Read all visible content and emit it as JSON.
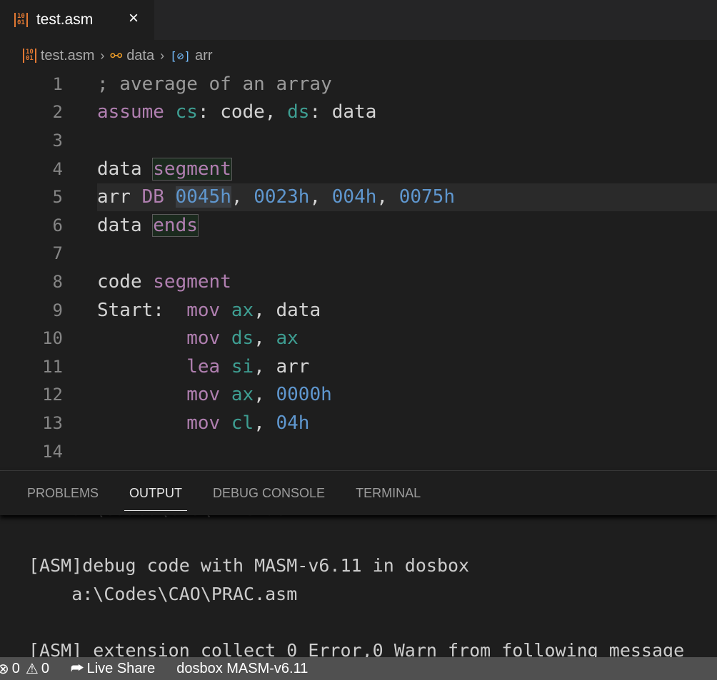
{
  "tab": {
    "icon": "binary-file-icon",
    "icon_text": "10 01",
    "label": "test.asm",
    "close": "×"
  },
  "breadcrumb": {
    "file": "test.asm",
    "namespace": "data",
    "symbol": "arr"
  },
  "editor": {
    "lines": [
      {
        "n": "1",
        "tokens": [
          {
            "t": "; average of an array",
            "c": "comment"
          }
        ]
      },
      {
        "n": "2",
        "tokens": [
          {
            "t": "assume",
            "c": "kw"
          },
          {
            "t": " ",
            "c": "plain"
          },
          {
            "t": "cs",
            "c": "reg"
          },
          {
            "t": ": code, ",
            "c": "plain"
          },
          {
            "t": "ds",
            "c": "reg"
          },
          {
            "t": ": data",
            "c": "plain"
          }
        ]
      },
      {
        "n": "3",
        "tokens": []
      },
      {
        "n": "4",
        "tokens": [
          {
            "t": "data ",
            "c": "plain"
          },
          {
            "t": "segment",
            "c": "kw",
            "h": "box"
          }
        ]
      },
      {
        "n": "5",
        "current": true,
        "tokens": [
          {
            "t": "arr ",
            "c": "plain"
          },
          {
            "t": "DB",
            "c": "kw"
          },
          {
            "t": " ",
            "c": "plain"
          },
          {
            "t": "0045h",
            "c": "num",
            "h": "sel"
          },
          {
            "t": ", ",
            "c": "plain"
          },
          {
            "t": "0023h",
            "c": "num"
          },
          {
            "t": ", ",
            "c": "plain"
          },
          {
            "t": "004h",
            "c": "num"
          },
          {
            "t": ", ",
            "c": "plain"
          },
          {
            "t": "0075h",
            "c": "num"
          }
        ]
      },
      {
        "n": "6",
        "tokens": [
          {
            "t": "data ",
            "c": "plain"
          },
          {
            "t": "ends",
            "c": "kw",
            "h": "box"
          }
        ]
      },
      {
        "n": "7",
        "tokens": []
      },
      {
        "n": "8",
        "tokens": [
          {
            "t": "code ",
            "c": "plain"
          },
          {
            "t": "segment",
            "c": "kw"
          }
        ]
      },
      {
        "n": "9",
        "tokens": [
          {
            "t": "Start:  ",
            "c": "plain"
          },
          {
            "t": "mov",
            "c": "kw"
          },
          {
            "t": " ",
            "c": "plain"
          },
          {
            "t": "ax",
            "c": "reg"
          },
          {
            "t": ", data",
            "c": "plain"
          }
        ]
      },
      {
        "n": "10",
        "tokens": [
          {
            "t": "        ",
            "c": "plain"
          },
          {
            "t": "mov",
            "c": "kw"
          },
          {
            "t": " ",
            "c": "plain"
          },
          {
            "t": "ds",
            "c": "reg"
          },
          {
            "t": ", ",
            "c": "plain"
          },
          {
            "t": "ax",
            "c": "reg"
          }
        ]
      },
      {
        "n": "11",
        "tokens": [
          {
            "t": "        ",
            "c": "plain"
          },
          {
            "t": "lea",
            "c": "kw"
          },
          {
            "t": " ",
            "c": "plain"
          },
          {
            "t": "si",
            "c": "reg"
          },
          {
            "t": ", arr",
            "c": "plain"
          }
        ]
      },
      {
        "n": "12",
        "tokens": [
          {
            "t": "        ",
            "c": "plain"
          },
          {
            "t": "mov",
            "c": "kw"
          },
          {
            "t": " ",
            "c": "plain"
          },
          {
            "t": "ax",
            "c": "reg"
          },
          {
            "t": ", ",
            "c": "plain"
          },
          {
            "t": "0000h",
            "c": "num"
          }
        ]
      },
      {
        "n": "13",
        "tokens": [
          {
            "t": "        ",
            "c": "plain"
          },
          {
            "t": "mov",
            "c": "kw"
          },
          {
            "t": " ",
            "c": "plain"
          },
          {
            "t": "cl",
            "c": "reg"
          },
          {
            "t": ", ",
            "c": "plain"
          },
          {
            "t": "04h",
            "c": "num"
          }
        ]
      },
      {
        "n": "14",
        "tokens": []
      }
    ]
  },
  "panel": {
    "tabs": [
      "PROBLEMS",
      "OUTPUT",
      "DEBUG CONSOLE",
      "TERMINAL"
    ],
    "active": "OUTPUT",
    "output": [
      "    a:\\Codes\\CAO\\PRAC.asm",
      "",
      "[ASM]debug code with MASM-v6.11 in dosbox",
      "    a:\\Codes\\CAO\\PRAC.asm",
      "",
      "[ASM] extension collect 0 Error,0 Warn from following message"
    ]
  },
  "status": {
    "errors": "0",
    "warnings": "0",
    "live_share": "Live Share",
    "dosbox": "dosbox MASM-v6.11"
  },
  "colors": {
    "keyword": "#b07fb0",
    "register": "#3e9e92",
    "number": "#5f97cf",
    "comment": "#9a9a9a",
    "file_icon": "#e37933",
    "status_bar": "#505050"
  }
}
